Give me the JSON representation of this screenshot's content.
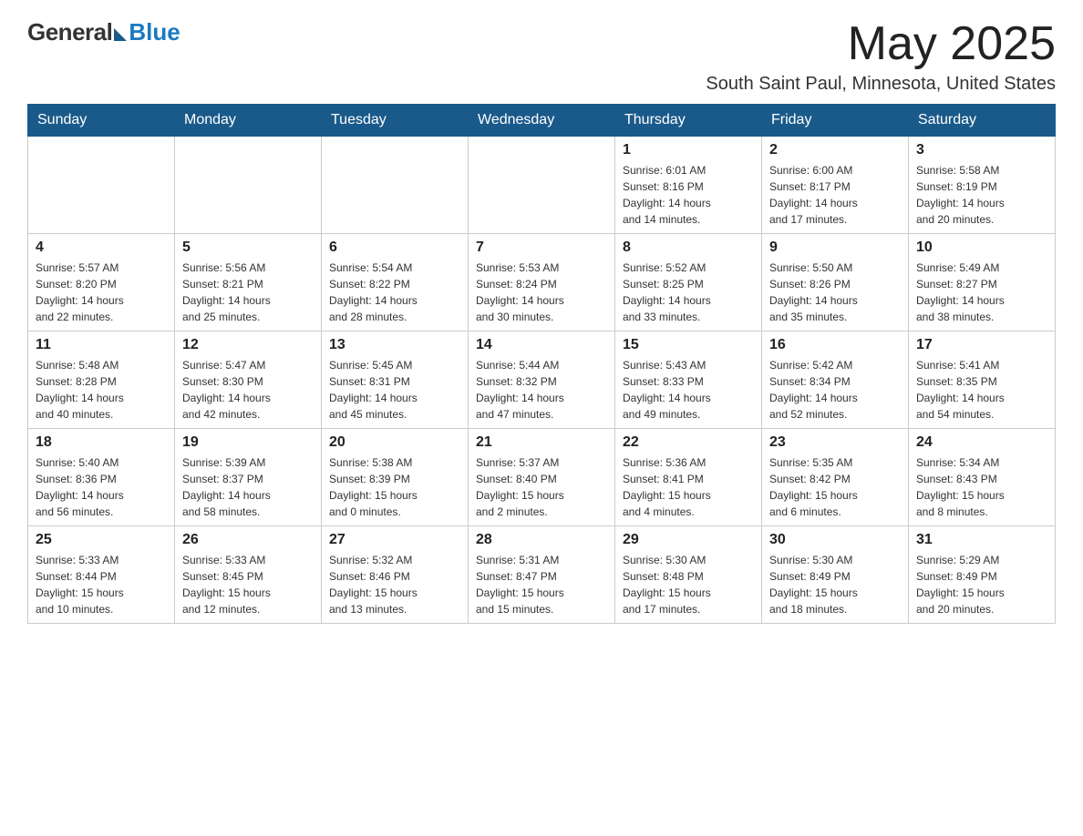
{
  "header": {
    "logo_general": "General",
    "logo_blue": "Blue",
    "month_year": "May 2025",
    "location": "South Saint Paul, Minnesota, United States"
  },
  "days_of_week": [
    "Sunday",
    "Monday",
    "Tuesday",
    "Wednesday",
    "Thursday",
    "Friday",
    "Saturday"
  ],
  "weeks": [
    [
      {
        "day": "",
        "info": ""
      },
      {
        "day": "",
        "info": ""
      },
      {
        "day": "",
        "info": ""
      },
      {
        "day": "",
        "info": ""
      },
      {
        "day": "1",
        "info": "Sunrise: 6:01 AM\nSunset: 8:16 PM\nDaylight: 14 hours\nand 14 minutes."
      },
      {
        "day": "2",
        "info": "Sunrise: 6:00 AM\nSunset: 8:17 PM\nDaylight: 14 hours\nand 17 minutes."
      },
      {
        "day": "3",
        "info": "Sunrise: 5:58 AM\nSunset: 8:19 PM\nDaylight: 14 hours\nand 20 minutes."
      }
    ],
    [
      {
        "day": "4",
        "info": "Sunrise: 5:57 AM\nSunset: 8:20 PM\nDaylight: 14 hours\nand 22 minutes."
      },
      {
        "day": "5",
        "info": "Sunrise: 5:56 AM\nSunset: 8:21 PM\nDaylight: 14 hours\nand 25 minutes."
      },
      {
        "day": "6",
        "info": "Sunrise: 5:54 AM\nSunset: 8:22 PM\nDaylight: 14 hours\nand 28 minutes."
      },
      {
        "day": "7",
        "info": "Sunrise: 5:53 AM\nSunset: 8:24 PM\nDaylight: 14 hours\nand 30 minutes."
      },
      {
        "day": "8",
        "info": "Sunrise: 5:52 AM\nSunset: 8:25 PM\nDaylight: 14 hours\nand 33 minutes."
      },
      {
        "day": "9",
        "info": "Sunrise: 5:50 AM\nSunset: 8:26 PM\nDaylight: 14 hours\nand 35 minutes."
      },
      {
        "day": "10",
        "info": "Sunrise: 5:49 AM\nSunset: 8:27 PM\nDaylight: 14 hours\nand 38 minutes."
      }
    ],
    [
      {
        "day": "11",
        "info": "Sunrise: 5:48 AM\nSunset: 8:28 PM\nDaylight: 14 hours\nand 40 minutes."
      },
      {
        "day": "12",
        "info": "Sunrise: 5:47 AM\nSunset: 8:30 PM\nDaylight: 14 hours\nand 42 minutes."
      },
      {
        "day": "13",
        "info": "Sunrise: 5:45 AM\nSunset: 8:31 PM\nDaylight: 14 hours\nand 45 minutes."
      },
      {
        "day": "14",
        "info": "Sunrise: 5:44 AM\nSunset: 8:32 PM\nDaylight: 14 hours\nand 47 minutes."
      },
      {
        "day": "15",
        "info": "Sunrise: 5:43 AM\nSunset: 8:33 PM\nDaylight: 14 hours\nand 49 minutes."
      },
      {
        "day": "16",
        "info": "Sunrise: 5:42 AM\nSunset: 8:34 PM\nDaylight: 14 hours\nand 52 minutes."
      },
      {
        "day": "17",
        "info": "Sunrise: 5:41 AM\nSunset: 8:35 PM\nDaylight: 14 hours\nand 54 minutes."
      }
    ],
    [
      {
        "day": "18",
        "info": "Sunrise: 5:40 AM\nSunset: 8:36 PM\nDaylight: 14 hours\nand 56 minutes."
      },
      {
        "day": "19",
        "info": "Sunrise: 5:39 AM\nSunset: 8:37 PM\nDaylight: 14 hours\nand 58 minutes."
      },
      {
        "day": "20",
        "info": "Sunrise: 5:38 AM\nSunset: 8:39 PM\nDaylight: 15 hours\nand 0 minutes."
      },
      {
        "day": "21",
        "info": "Sunrise: 5:37 AM\nSunset: 8:40 PM\nDaylight: 15 hours\nand 2 minutes."
      },
      {
        "day": "22",
        "info": "Sunrise: 5:36 AM\nSunset: 8:41 PM\nDaylight: 15 hours\nand 4 minutes."
      },
      {
        "day": "23",
        "info": "Sunrise: 5:35 AM\nSunset: 8:42 PM\nDaylight: 15 hours\nand 6 minutes."
      },
      {
        "day": "24",
        "info": "Sunrise: 5:34 AM\nSunset: 8:43 PM\nDaylight: 15 hours\nand 8 minutes."
      }
    ],
    [
      {
        "day": "25",
        "info": "Sunrise: 5:33 AM\nSunset: 8:44 PM\nDaylight: 15 hours\nand 10 minutes."
      },
      {
        "day": "26",
        "info": "Sunrise: 5:33 AM\nSunset: 8:45 PM\nDaylight: 15 hours\nand 12 minutes."
      },
      {
        "day": "27",
        "info": "Sunrise: 5:32 AM\nSunset: 8:46 PM\nDaylight: 15 hours\nand 13 minutes."
      },
      {
        "day": "28",
        "info": "Sunrise: 5:31 AM\nSunset: 8:47 PM\nDaylight: 15 hours\nand 15 minutes."
      },
      {
        "day": "29",
        "info": "Sunrise: 5:30 AM\nSunset: 8:48 PM\nDaylight: 15 hours\nand 17 minutes."
      },
      {
        "day": "30",
        "info": "Sunrise: 5:30 AM\nSunset: 8:49 PM\nDaylight: 15 hours\nand 18 minutes."
      },
      {
        "day": "31",
        "info": "Sunrise: 5:29 AM\nSunset: 8:49 PM\nDaylight: 15 hours\nand 20 minutes."
      }
    ]
  ]
}
